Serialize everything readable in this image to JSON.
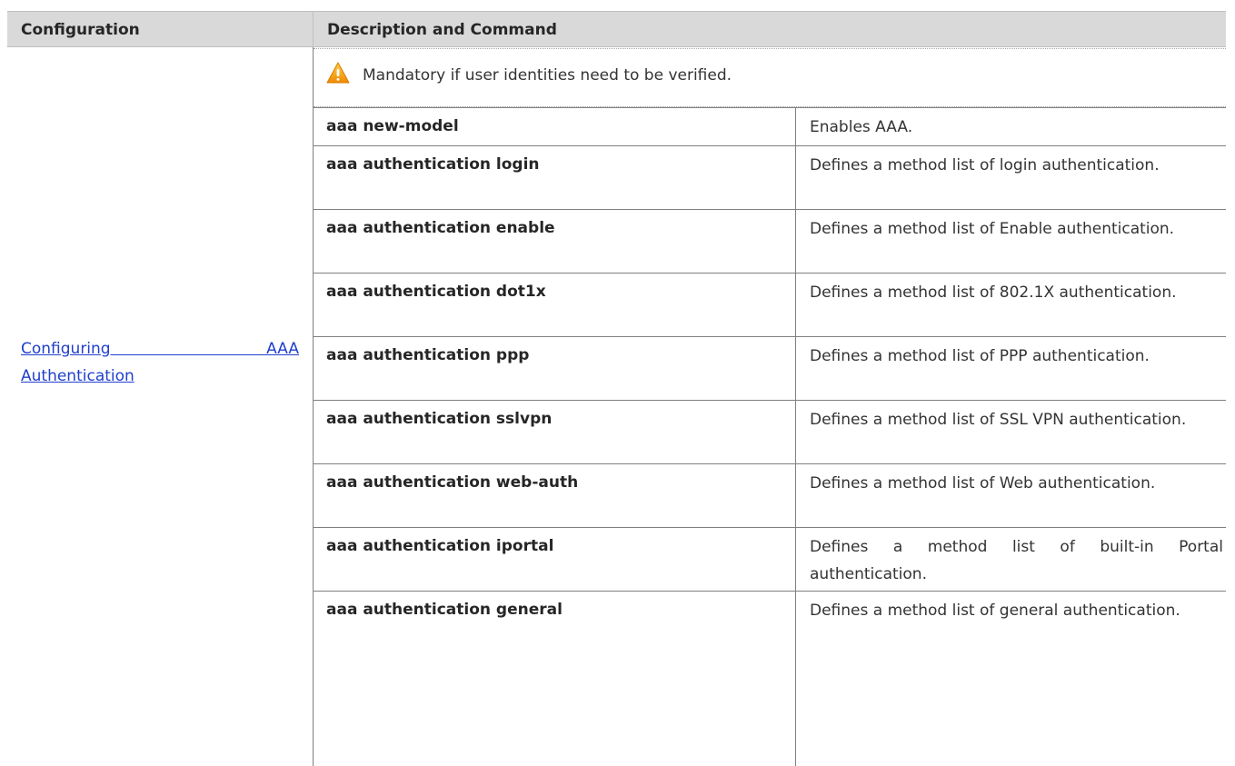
{
  "header": {
    "configuration_label": "Configuration",
    "description_label": "Description and Command"
  },
  "configuration_link": {
    "line1": "Configuring AAA",
    "line2": "Authentication"
  },
  "notice": {
    "icon": "warning-icon",
    "text": "Mandatory if user identities need to be verified."
  },
  "commands": [
    {
      "command": "aaa new-model",
      "description": "Enables AAA."
    },
    {
      "command": "aaa authentication login",
      "description": "Defines a method list of login authentication."
    },
    {
      "command": "aaa authentication enable",
      "description": "Defines a method list of Enable authentication."
    },
    {
      "command": "aaa authentication dot1x",
      "description": "Defines a method list of 802.1X authentication."
    },
    {
      "command": "aaa authentication ppp",
      "description": "Defines a method list of PPP authentication."
    },
    {
      "command": "aaa authentication sslvpn",
      "description": "Defines a method list of SSL VPN authentication."
    },
    {
      "command": "aaa authentication web-auth",
      "description": "Defines a method list of Web authentication."
    },
    {
      "command": "aaa authentication iportal",
      "description": "Defines a method list of built-in Portal authentication."
    },
    {
      "command": "aaa authentication general",
      "description": "Defines a method list of general authentication."
    }
  ],
  "colors": {
    "header_bg": "#d9d9d9",
    "link": "#1f3fcc",
    "warning": "#f5a623"
  }
}
